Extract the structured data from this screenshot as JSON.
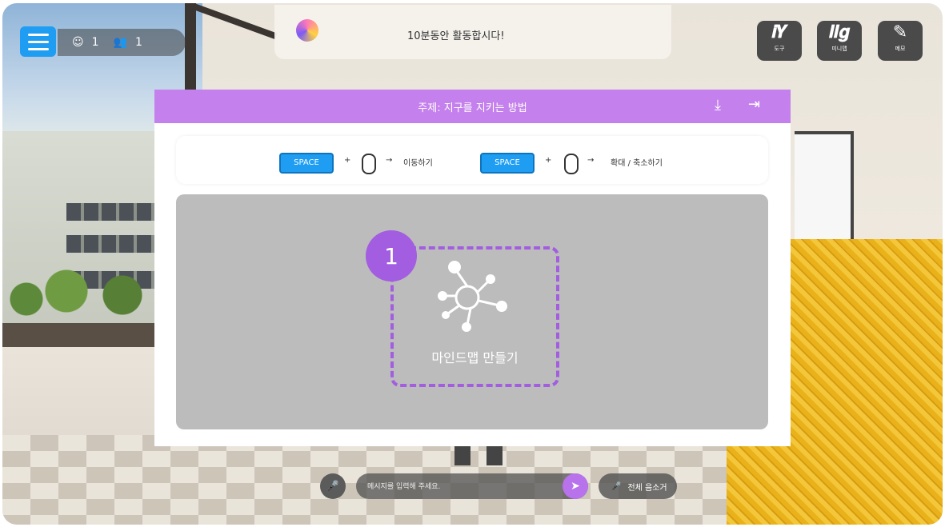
{
  "hud": {
    "user_count_1": "1",
    "user_count_2": "1",
    "notice_text": "10분동안 활동합시다!"
  },
  "tools": [
    {
      "label": "도구",
      "icon": "tools-icon"
    },
    {
      "label": "미니맵",
      "icon": "minimap-icon"
    },
    {
      "label": "메모",
      "icon": "memo-icon"
    }
  ],
  "modal": {
    "title": "주제: 지구를 지키는 방법",
    "guide": {
      "key1": "SPACE",
      "action1": "이동하기",
      "key2": "SPACE",
      "action2": "확대 / 축소하기"
    },
    "mindmap_label": "마인드맵 만들기",
    "step_badge": "1"
  },
  "chat": {
    "placeholder": "메시지를 입력해 주세요.",
    "mute_all": "전체 음소거"
  },
  "colors": {
    "accent_purple": "#c480ec",
    "badge_purple": "#a25de0",
    "key_blue": "#1e9df2"
  }
}
